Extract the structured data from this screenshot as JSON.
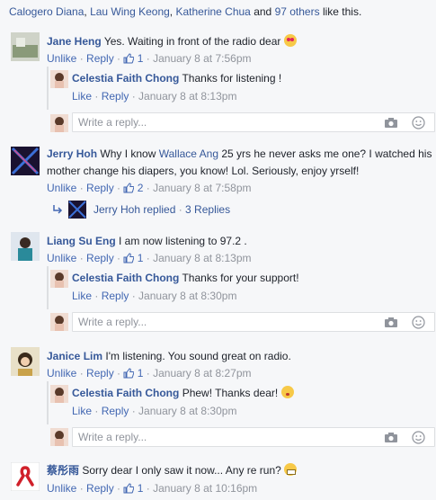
{
  "likes_summary": {
    "names": [
      "Calogero Diana",
      "Lau Wing Keong",
      "Katherine Chua"
    ],
    "sep": ", ",
    "and": " and ",
    "others": "97 others",
    "suffix": " like this."
  },
  "action": {
    "unlike": "Unlike",
    "like": "Like",
    "reply": "Reply",
    "dot": " · "
  },
  "write_placeholder": "Write a reply...",
  "comments": [
    {
      "author": "Jane Heng",
      "text": "Yes. Waiting in front of the radio dear",
      "emoji": "heart-eyes",
      "likes": "1",
      "time": "January 8 at 7:56pm"
    },
    {
      "author": "Jerry Hoh",
      "text_before": "Why I know ",
      "mention": "Wallace Ang",
      "text_after": " 25 yrs he never asks me one? I watched his",
      "text_line2": "mother change his diapers, you know! Lol. Seriously, enjoy yrself!",
      "likes": "2",
      "time": "January 8 at 7:58pm"
    },
    {
      "author": "Liang Su Eng",
      "text": "I am now listening to 97.2 .",
      "likes": "1",
      "time": "January 8 at 8:13pm"
    },
    {
      "author": "Janice Lim",
      "text": "I'm listening. You sound great on radio.",
      "likes": "1",
      "time": "January 8 at 8:27pm"
    },
    {
      "author": "蔡彤雨",
      "text": "Sorry dear I only saw it now... Any re run?",
      "emoji": "grin",
      "likes": "1",
      "time": "January 8 at 10:16pm"
    }
  ],
  "replies": [
    {
      "author": "Celestia Faith Chong",
      "text": "Thanks for listening !",
      "time": "January 8 at 8:13pm"
    },
    {
      "author": "Celestia Faith Chong",
      "text": "Thanks for your support!",
      "time": "January 8 at 8:30pm"
    },
    {
      "author": "Celestia Faith Chong",
      "text": "Phew! Thanks dear!",
      "emoji": "shush",
      "time": "January 8 at 8:30pm"
    }
  ],
  "jerry_replies": {
    "author": "Jerry Hoh",
    "replied": " replied",
    "dot": " · ",
    "count": "3 Replies"
  },
  "colors": {
    "link": "#365899",
    "meta": "#90949c",
    "action": "#4267b2",
    "background": "#f6f7f9"
  }
}
